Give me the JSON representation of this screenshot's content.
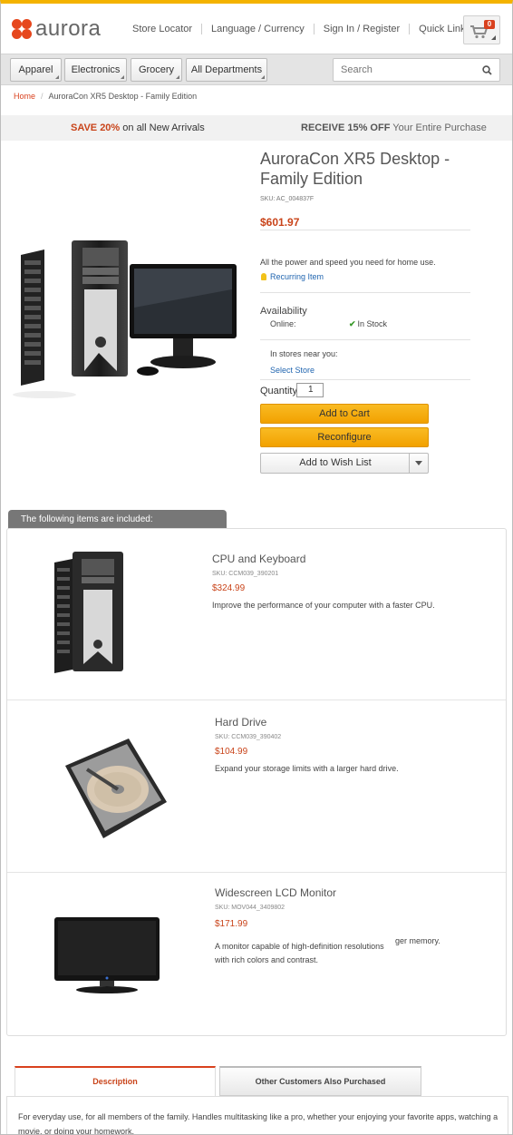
{
  "brand": {
    "name": "aurora",
    "accent": "#f4b300",
    "brand_red": "#e6471d"
  },
  "topnav": {
    "store_locator": "Store Locator",
    "language_currency": "Language / Currency",
    "sign_in": "Sign In / Register",
    "quick_links": "Quick Links"
  },
  "cart": {
    "count": "0",
    "icon": "cart-icon"
  },
  "departments": [
    "Apparel",
    "Electronics",
    "Grocery",
    "All Departments"
  ],
  "search": {
    "placeholder": "Search",
    "icon": "search-icon"
  },
  "breadcrumb": {
    "home": "Home",
    "current": "AuroraCon XR5 Desktop - Family Edition"
  },
  "promo": {
    "left_bold": "SAVE 20%",
    "left_rest": " on all New Arrivals",
    "right_bold": "RECEIVE 15% OFF",
    "right_rest": " Your Entire Purchase"
  },
  "product": {
    "name": "AuroraCon XR5 Desktop - Family Edition",
    "sku": "SKU: AC_004837F",
    "price": "$601.97",
    "tagline": "All the power and speed you need for home use.",
    "recurring": "Recurring Item",
    "availability_label": "Availability",
    "online_label": "Online:",
    "online_status": "In Stock",
    "stores_label": "In stores near you:",
    "select_store": "Select Store",
    "quantity_label": "Quantity",
    "quantity": "1",
    "add_to_cart": "Add to Cart",
    "reconfigure": "Reconfigure",
    "add_to_wishlist": "Add to Wish List"
  },
  "included": {
    "header": "The following items are included:",
    "items": [
      {
        "name": "CPU and Keyboard",
        "sku": "SKU: CCM039_390201",
        "price": "$324.99",
        "desc": "Improve the performance of your computer with a faster CPU.",
        "desc_extra": ""
      },
      {
        "name": "Hard Drive",
        "sku": "SKU: CCM039_390402",
        "price": "$104.99",
        "desc": "Expand your storage limits with a larger hard drive.",
        "desc_extra": ""
      },
      {
        "name": "Widescreen LCD Monitor",
        "sku": "SKU: MOV044_3409802",
        "price": "$171.99",
        "desc": "A monitor capable of high-definition resolutions with rich colors and contrast.",
        "desc_extra": "ger memory."
      }
    ]
  },
  "tabs": {
    "description": "Description",
    "also_purchased": "Other Customers Also Purchased"
  },
  "description_text": "For everyday use, for all members of the family. Handles multitasking like a pro, whether your enjoying your favorite apps, watching a movie, or doing your homework."
}
